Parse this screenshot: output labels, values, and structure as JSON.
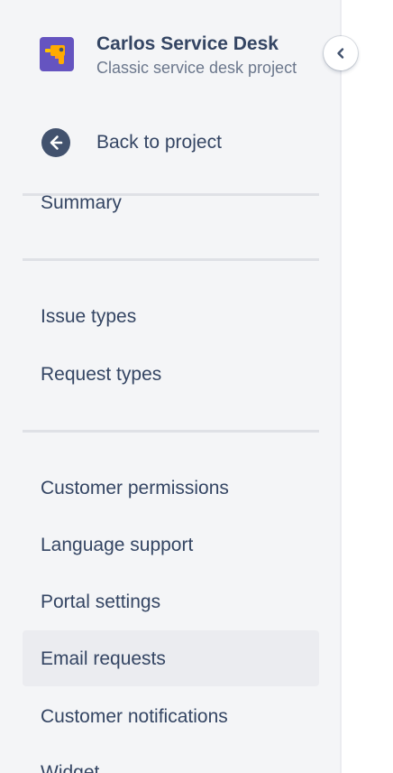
{
  "project": {
    "name": "Carlos Service Desk",
    "type": "Classic service desk project",
    "avatar_color": "#6554c0",
    "avatar_icon": "drill-icon"
  },
  "back": {
    "label": "Back to project",
    "icon": "arrow-left-circle-icon"
  },
  "sidebar": {
    "groups": [
      {
        "items": [
          {
            "label": "Summary"
          }
        ]
      },
      {
        "items": [
          {
            "label": "Issue types"
          },
          {
            "label": "Request types"
          }
        ]
      },
      {
        "items": [
          {
            "label": "Customer permissions"
          },
          {
            "label": "Language support"
          },
          {
            "label": "Portal settings"
          },
          {
            "label": "Email requests",
            "selected": true
          },
          {
            "label": "Customer notifications"
          },
          {
            "label": "Widget"
          }
        ]
      }
    ]
  },
  "collapse": {
    "icon": "chevron-left-icon"
  },
  "colors": {
    "sidebar_bg": "#f4f5f7",
    "text": "#344563",
    "subtext": "#6b778c",
    "selected_bg": "#ebecf0",
    "divider": "#dfe1e6"
  }
}
